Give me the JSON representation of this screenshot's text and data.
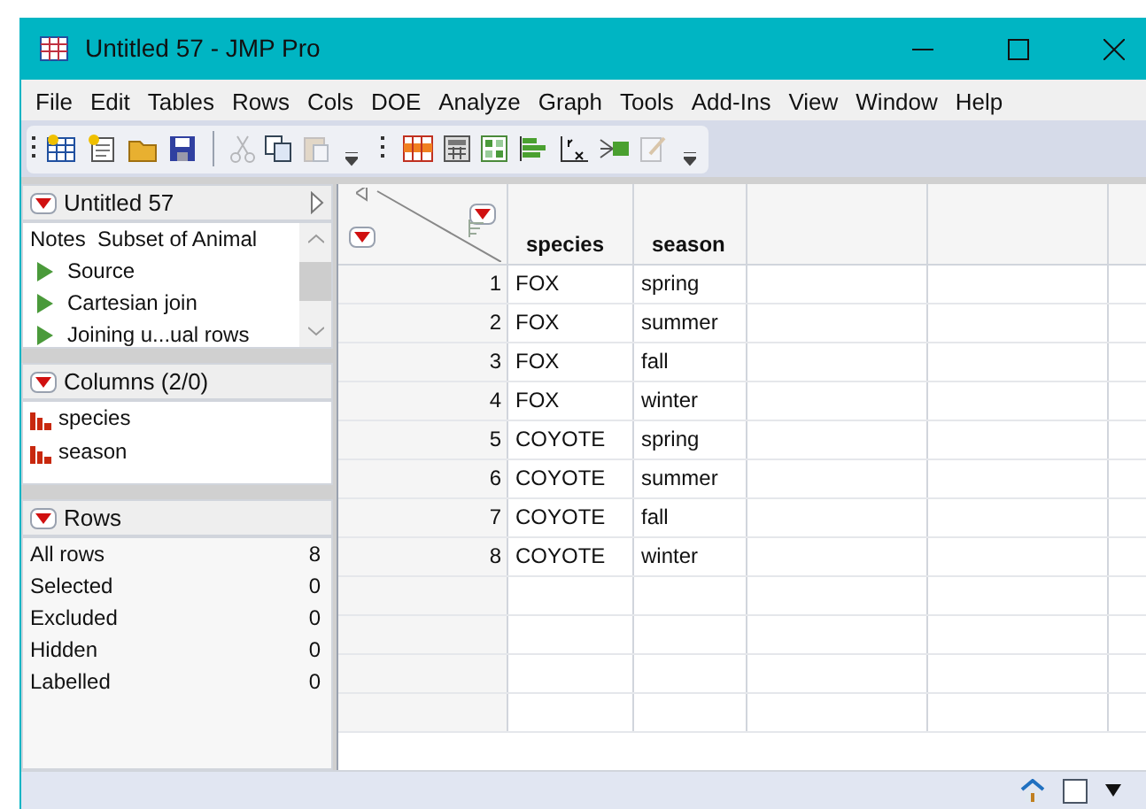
{
  "window": {
    "title": "Untitled 57 - JMP Pro"
  },
  "menu": [
    "File",
    "Edit",
    "Tables",
    "Rows",
    "Cols",
    "DOE",
    "Analyze",
    "Graph",
    "Tools",
    "Add-Ins",
    "View",
    "Window",
    "Help"
  ],
  "toolbar": [
    {
      "kind": "new-table",
      "disabled": false
    },
    {
      "kind": "new-script",
      "disabled": false
    },
    {
      "kind": "open",
      "disabled": false
    },
    {
      "kind": "save",
      "disabled": false
    },
    {
      "kind": "separator"
    },
    {
      "kind": "cut",
      "disabled": true
    },
    {
      "kind": "copy",
      "disabled": false
    },
    {
      "kind": "paste",
      "disabled": true
    },
    {
      "kind": "overflow"
    },
    {
      "kind": "group"
    },
    {
      "kind": "data-grid",
      "disabled": false
    },
    {
      "kind": "calculator",
      "disabled": false
    },
    {
      "kind": "tiles",
      "disabled": false
    },
    {
      "kind": "bars",
      "disabled": false
    },
    {
      "kind": "fit-yx",
      "disabled": false
    },
    {
      "kind": "flow",
      "disabled": false
    },
    {
      "kind": "edit",
      "disabled": true
    },
    {
      "kind": "overflow"
    }
  ],
  "table_panel": {
    "title": "Untitled 57",
    "notes": "Notes  Subset of Animal",
    "scripts": [
      "Source",
      "Cartesian join",
      "Joining u...ual rows"
    ]
  },
  "columns_panel": {
    "title": "Columns (2/0)",
    "columns": [
      "species",
      "season"
    ]
  },
  "rows_panel": {
    "title": "Rows",
    "stats": [
      {
        "label": "All rows",
        "value": "8"
      },
      {
        "label": "Selected",
        "value": "0"
      },
      {
        "label": "Excluded",
        "value": "0"
      },
      {
        "label": "Hidden",
        "value": "0"
      },
      {
        "label": "Labelled",
        "value": "0"
      }
    ]
  },
  "grid": {
    "columns": [
      "species",
      "season"
    ],
    "rows": [
      {
        "number": "1",
        "cells": [
          "FOX",
          "spring"
        ]
      },
      {
        "number": "2",
        "cells": [
          "FOX",
          "summer"
        ]
      },
      {
        "number": "3",
        "cells": [
          "FOX",
          "fall"
        ]
      },
      {
        "number": "4",
        "cells": [
          "FOX",
          "winter"
        ]
      },
      {
        "number": "5",
        "cells": [
          "COYOTE",
          "spring"
        ]
      },
      {
        "number": "6",
        "cells": [
          "COYOTE",
          "summer"
        ]
      },
      {
        "number": "7",
        "cells": [
          "COYOTE",
          "fall"
        ]
      },
      {
        "number": "8",
        "cells": [
          "COYOTE",
          "winter"
        ]
      }
    ]
  }
}
